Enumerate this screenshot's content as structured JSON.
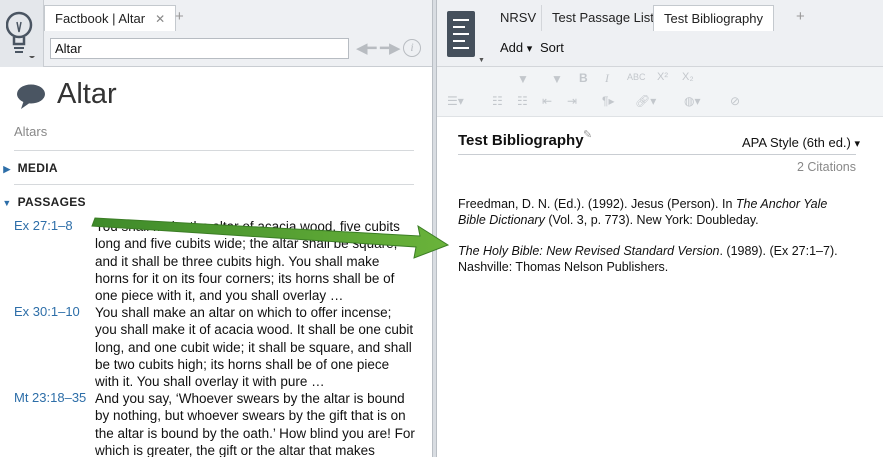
{
  "left_panel": {
    "tabs": [
      {
        "label": "Factbook | Altar",
        "close": "✕"
      }
    ],
    "add_tab": "+",
    "search_value": "Altar",
    "back_icon": "arrow-left-icon",
    "forward_icon": "arrow-right-icon",
    "info_icon": "i",
    "title": "Altar",
    "subtitle": "Altars",
    "sections": [
      {
        "label": "MEDIA",
        "expanded": false
      },
      {
        "label": "PASSAGES",
        "expanded": true
      }
    ],
    "passages": [
      {
        "ref": "Ex 27:1–8",
        "text": "You shall make the altar of acacia wood, five cubits long and five cubits wide; the altar shall be square, and it shall be three cubits high. You shall make horns for it on its four corners; its horns shall be of one piece with it, and you shall overlay …"
      },
      {
        "ref": "Ex 30:1–10",
        "text": "You shall make an altar on which to offer incense; you shall make it of acacia wood. It shall be one cubit long, and one cubit wide; it shall be square, and shall be two cubits high; its horns shall be of one piece with it. You shall overlay it with pure …"
      },
      {
        "ref": "Mt 23:18–35",
        "text": "And you say, ‘Whoever swears by the altar is bound by nothing, but whoever swears by the gift that is on the altar is bound by the oath.’ How blind you are! For which is greater, the gift or the altar that makes"
      }
    ]
  },
  "right_panel": {
    "tabs": [
      {
        "label": "NRSV"
      },
      {
        "label": "Test Passage List"
      },
      {
        "label": "Test Bibliography"
      }
    ],
    "add_tab": "+",
    "menu": {
      "add_label": "Add",
      "add_caret": "▾",
      "sort_label": "Sort"
    },
    "toolbar": {
      "bold": "B",
      "italic": "I",
      "smallcaps": "ABC",
      "superscript": "X²",
      "subscript": "X₂"
    },
    "bibliography": {
      "title": "Test Bibliography",
      "style": "APA Style (6th ed.)",
      "style_caret": "▾",
      "citations": "2 Citations",
      "entries": [
        {
          "plain1": "Freedman, D. N. (Ed.). (1992). Jesus (Person). In ",
          "italic": "The Anchor Yale Bible Dictionary",
          "plain2": " (Vol. 3, p. 773). New York: Doubleday."
        },
        {
          "plain1": "",
          "italic": "The Holy Bible: New Revised Standard Version",
          "plain2": ". (1989). (Ex 27:1–7). Nashville: Thomas Nelson Publishers."
        }
      ]
    }
  },
  "colors": {
    "link_blue": "#2d6ea8",
    "arrow_green": "#5aa02c",
    "panel_icon_dark": "#45505c"
  }
}
